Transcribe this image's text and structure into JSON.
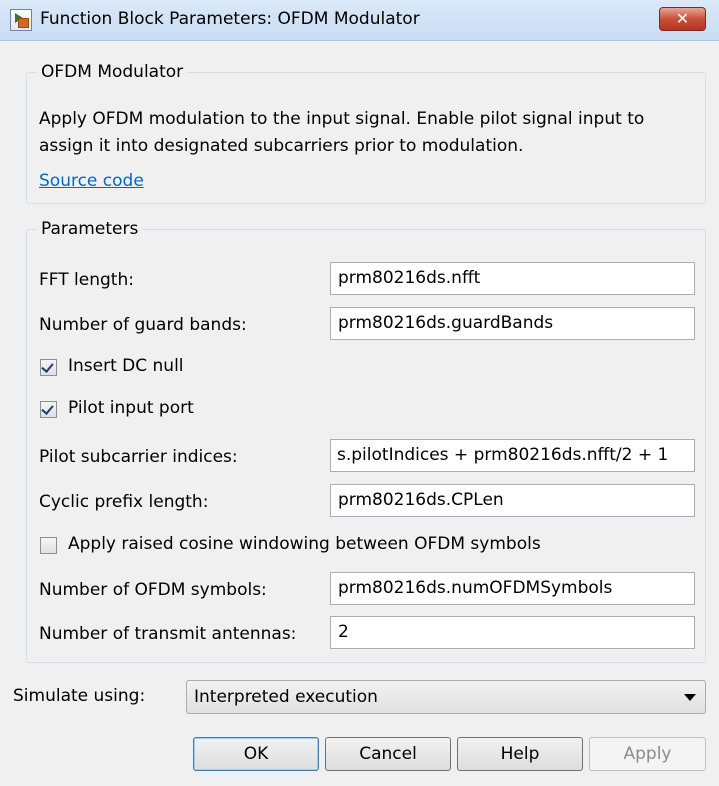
{
  "window": {
    "title": "Function Block Parameters: OFDM Modulator",
    "close_label": "✕"
  },
  "block_group": {
    "legend": "OFDM Modulator",
    "description": "Apply OFDM modulation to the input signal. Enable pilot signal input to assign it into designated subcarriers prior to modulation.",
    "link_label": "Source code"
  },
  "parameters": {
    "legend": "Parameters",
    "fft_length": {
      "label": "FFT length:",
      "value": "prm80216ds.nfft"
    },
    "guard_bands": {
      "label": "Number of guard bands:",
      "value": "prm80216ds.guardBands"
    },
    "insert_dc_null": {
      "label": "Insert DC null",
      "checked": true
    },
    "pilot_input_port": {
      "label": "Pilot input port",
      "checked": true
    },
    "pilot_indices": {
      "label": "Pilot subcarrier indices:",
      "value": "s.pilotIndices + prm80216ds.nfft/2 + 1"
    },
    "cyclic_prefix": {
      "label": "Cyclic prefix length:",
      "value": "prm80216ds.CPLen"
    },
    "raised_cosine": {
      "label": "Apply raised cosine windowing between OFDM symbols",
      "checked": false
    },
    "num_symbols": {
      "label": "Number of OFDM symbols:",
      "value": "prm80216ds.numOFDMSymbols"
    },
    "num_antennas": {
      "label": "Number of transmit antennas:",
      "value": "2"
    }
  },
  "simulate": {
    "label": "Simulate using:",
    "selected": "Interpreted execution"
  },
  "buttons": {
    "ok": "OK",
    "cancel": "Cancel",
    "help": "Help",
    "apply": "Apply"
  },
  "colors": {
    "link": "#0066cc",
    "close_button": "#c9503a",
    "window_bg": "#f0f0f0"
  }
}
